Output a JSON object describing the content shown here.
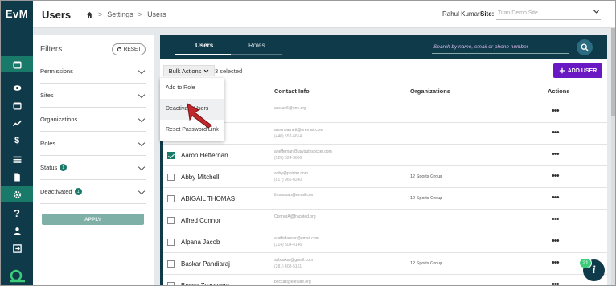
{
  "app": {
    "logo": "EvM"
  },
  "header": {
    "title": "Users",
    "breadcrumb": [
      "Settings",
      "Users"
    ],
    "user_name": "Rahul Kumar",
    "site_label": "Site:",
    "site_value": "Titan Demo Site"
  },
  "rail": {
    "icons": [
      "calendar-icon",
      "eye-icon",
      "calendar-icon",
      "chart-icon",
      "dollar-icon",
      "list-icon",
      "document-icon",
      "gear-icon",
      "help-icon",
      "person-icon",
      "logout-icon"
    ],
    "active": "gear-icon"
  },
  "filters": {
    "title": "Filters",
    "reset_label": "RESET",
    "items": [
      {
        "label": "Permissions",
        "badge": ""
      },
      {
        "label": "Sites",
        "badge": ""
      },
      {
        "label": "Organizations",
        "badge": ""
      },
      {
        "label": "Roles",
        "badge": ""
      },
      {
        "label": "Status",
        "badge": "1"
      },
      {
        "label": "Deactivated",
        "badge": "1"
      }
    ],
    "apply_label": "APPLY"
  },
  "tabs": {
    "users": "Users",
    "roles": "Roles"
  },
  "search": {
    "placeholder": "Search by name, email or phone number"
  },
  "toolbar": {
    "bulk_label": "Bulk Actions",
    "selected_text": "3 selected",
    "add_user_label": "ADD USER"
  },
  "columns": {
    "contact": "Contact Info",
    "organizations": "Organizations",
    "actions": "Actions"
  },
  "bulk_menu": [
    "Add to Role",
    "Deactivate Users",
    "Reset Password Link"
  ],
  "rows": [
    {
      "name": "",
      "email": "accrue6@one.org",
      "phone": "",
      "org": "",
      "checked": false
    },
    {
      "name": "",
      "email": "aaronbarnett@oremail.com",
      "phone": "(440) 552-6614",
      "org": "",
      "checked": false
    },
    {
      "name": "Aaron Heffernan",
      "email": "aheffernan@usyouthsoccer.com",
      "phone": "(520) 624-3606",
      "org": "",
      "checked": true
    },
    {
      "name": "Abby Mitchell",
      "email": "abby@pointer.com",
      "phone": "(817) 966-0240",
      "org": "12 Sports Group",
      "checked": false
    },
    {
      "name": "ABIGAIL THOMAS",
      "email": "thomasab@email.com",
      "phone": "",
      "org": "12 Sports Group",
      "checked": false
    },
    {
      "name": "Alfred Connor",
      "email": "ConnorA@fracoted.org",
      "phone": "",
      "org": "",
      "checked": false
    },
    {
      "name": "Alpana Jacob",
      "email": "arathidancer@email.com",
      "phone": "(214) 504-4146",
      "org": "",
      "checked": false
    },
    {
      "name": "Baskar Pandiaraj",
      "email": "spbaskar@gmail.com",
      "phone": "(281) 403-5161",
      "org": "12 Sports Group",
      "checked": false
    },
    {
      "name": "Becca Zuzunaga",
      "email": "beccaz@elevate.org",
      "phone": "",
      "org": "",
      "checked": false
    }
  ],
  "row_actions": "•••",
  "chat": {
    "count": "21",
    "icon": "i"
  }
}
